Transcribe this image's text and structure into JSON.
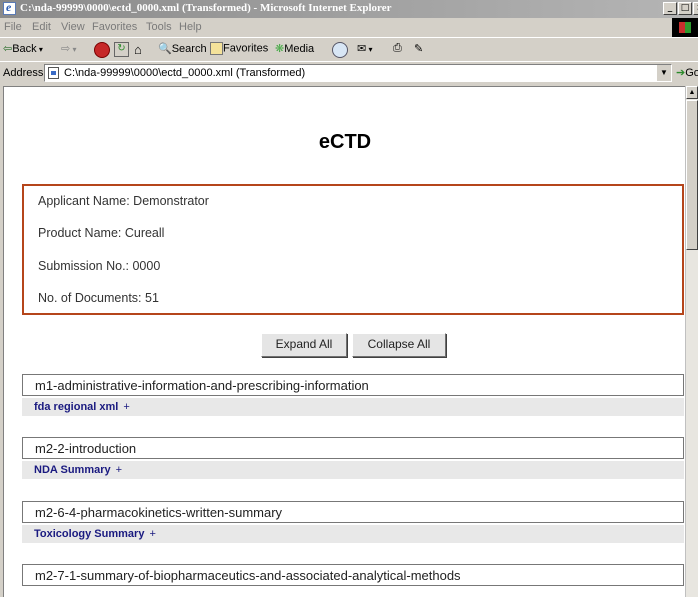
{
  "window": {
    "title": "C:\\nda-99999\\0000\\ectd_0000.xml (Transformed) - Microsoft Internet Explorer",
    "minimize": "_",
    "maximize": "□",
    "close": "×"
  },
  "menu": {
    "items": [
      "File",
      "Edit",
      "View",
      "Favorites",
      "Tools",
      "Help"
    ]
  },
  "toolbar": {
    "back": "Back",
    "search": "Search",
    "favorites": "Favorites",
    "media": "Media"
  },
  "address": {
    "label": "Address",
    "value": "C:\\nda-99999\\0000\\ectd_0000.xml (Transformed)",
    "go": "Go"
  },
  "page": {
    "title": "eCTD",
    "info": {
      "applicant": "Applicant Name: Demonstrator",
      "product": "Product Name: Cureall",
      "submission": "Submission No.: 0000",
      "documents": "No. of Documents: 51"
    },
    "buttons": {
      "expand": "Expand All",
      "collapse": "Collapse All"
    },
    "sections": [
      {
        "title": "m1-administrative-information-and-prescribing-information",
        "sub": "fda regional xml",
        "plus": "+"
      },
      {
        "title": "m2-2-introduction",
        "sub": "NDA Summary",
        "plus": "+"
      },
      {
        "title": "m2-6-4-pharmacokinetics-written-summary",
        "sub": "Toxicology Summary",
        "plus": "+"
      },
      {
        "title": "m2-7-1-summary-of-biopharmaceutics-and-associated-analytical-methods"
      }
    ]
  }
}
